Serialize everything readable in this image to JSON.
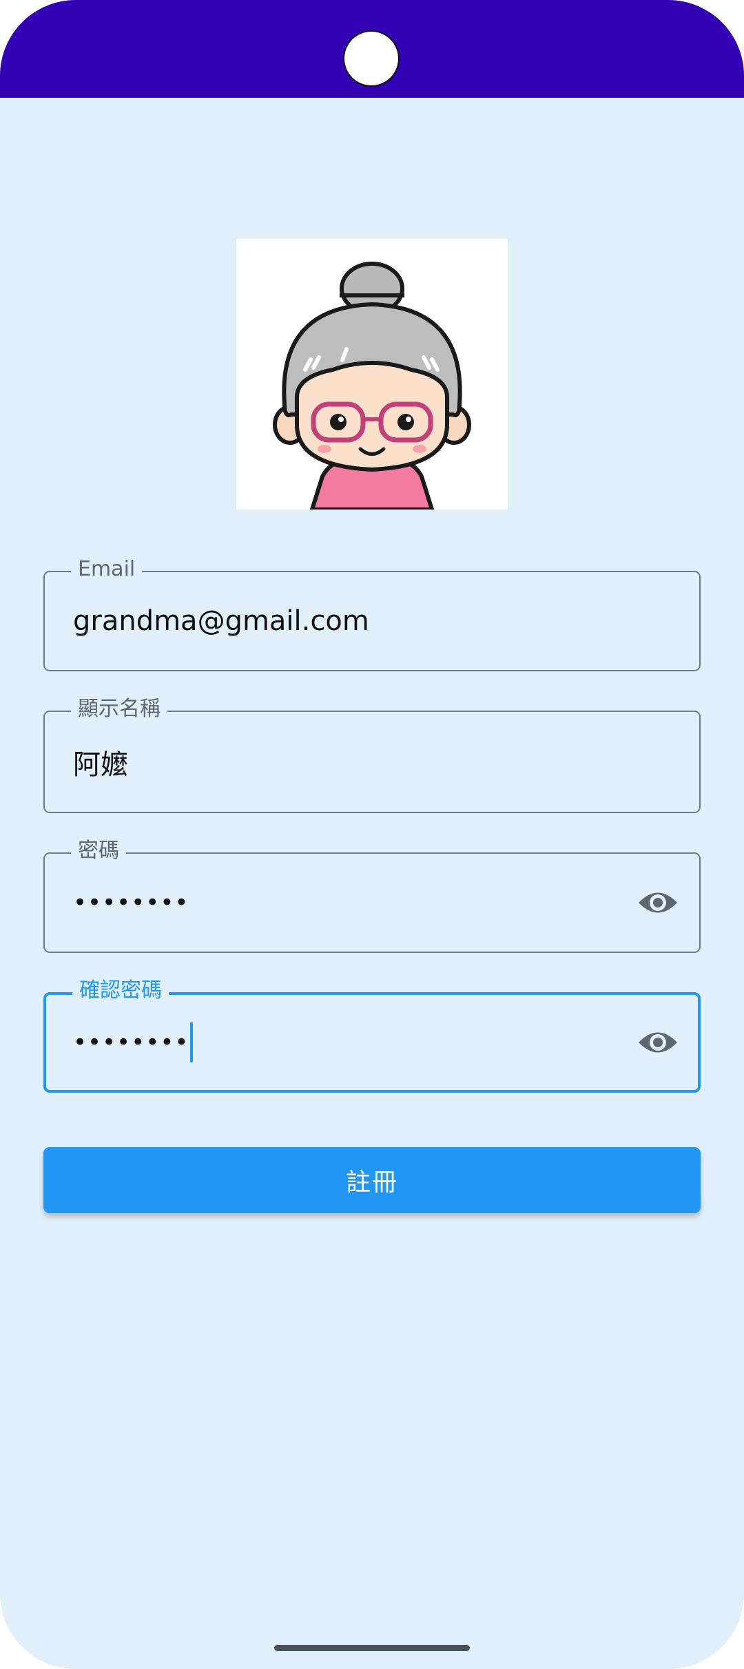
{
  "theme": {
    "status_bar_color": "#3300B3",
    "background_color": "#E1EFFB",
    "accent_color": "#2196F3",
    "outline_color": "#6F7A85"
  },
  "avatar": {
    "icon": "grandma-avatar"
  },
  "form": {
    "email": {
      "label": "Email",
      "value": "grandma@gmail.com"
    },
    "display_name": {
      "label": "顯示名稱",
      "value": "阿嬤"
    },
    "password": {
      "label": "密碼",
      "value": "••••••••",
      "toggle_icon": "eye-icon"
    },
    "confirm_password": {
      "label": "確認密碼",
      "value": "••••••••",
      "toggle_icon": "eye-icon",
      "focused": true
    }
  },
  "register_button": {
    "label": "註冊"
  }
}
